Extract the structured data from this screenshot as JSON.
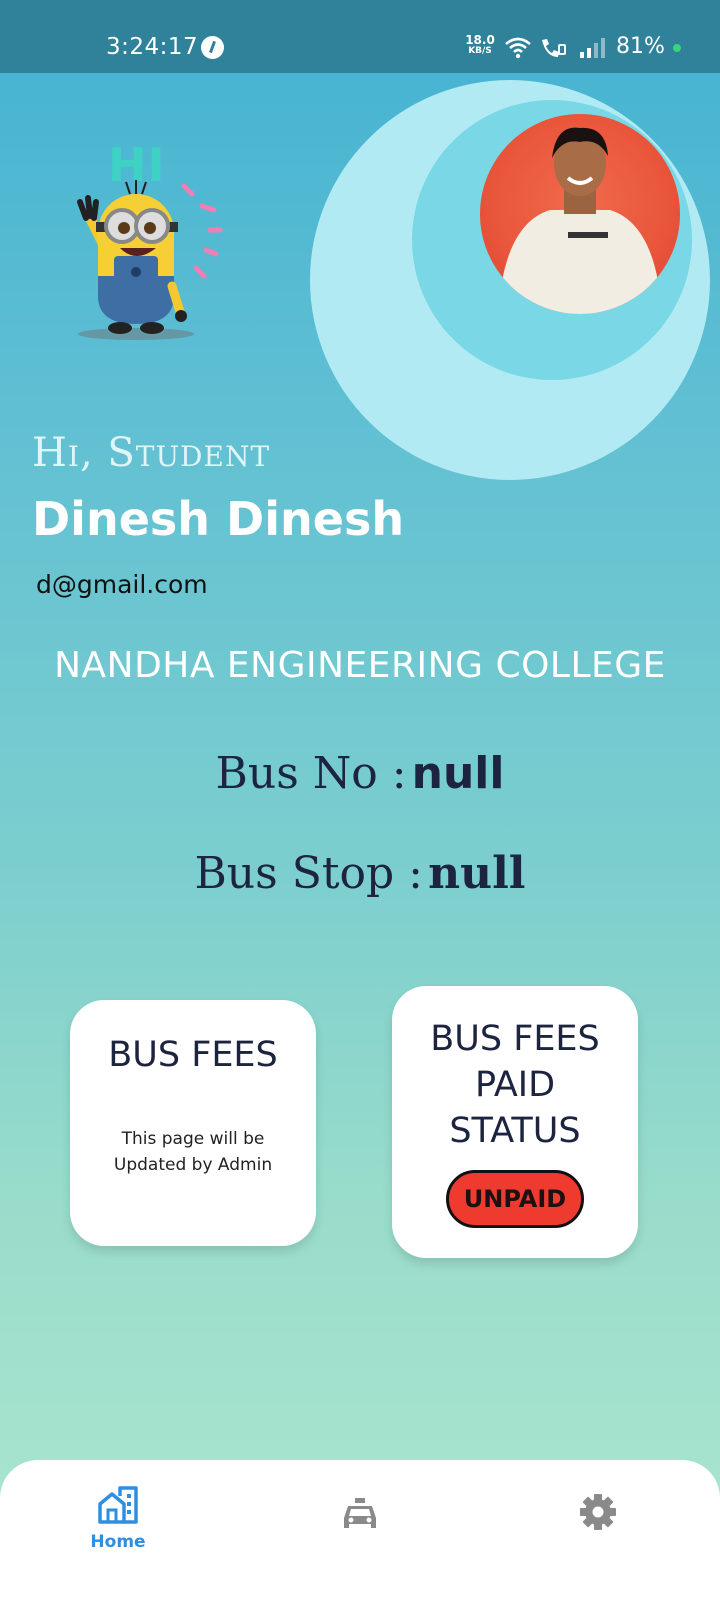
{
  "status_bar": {
    "time": "3:24:17",
    "net_speed_value": "18.0",
    "net_speed_unit": "KB/S",
    "battery": "81%"
  },
  "illustration": {
    "hi_text": "HI"
  },
  "profile": {
    "greeting": "Hi, Student",
    "name": "Dinesh Dinesh",
    "email": "d@gmail.com",
    "college": "NANDHA ENGINEERING COLLEGE"
  },
  "bus_info": {
    "bus_no_label": "Bus No :",
    "bus_no_value": "null",
    "bus_stop_label": "Bus Stop :",
    "bus_stop_value": "null"
  },
  "cards": {
    "fees_title": "BUS FEES",
    "fees_note_line1": "This page will be",
    "fees_note_line2": "Updated by Admin",
    "status_title_line1": "BUS FEES",
    "status_title_line2": "PAID",
    "status_title_line3": "STATUS",
    "status_value": "UNPAID"
  },
  "bottom_nav": {
    "home_label": "Home",
    "icons": [
      "home-icon",
      "car-icon",
      "gear-icon"
    ]
  },
  "colors": {
    "status_bar": "#2f8299",
    "accent": "#2e8fe0",
    "unpaid": "#ef3b2f",
    "text_dark": "#1d2440"
  }
}
